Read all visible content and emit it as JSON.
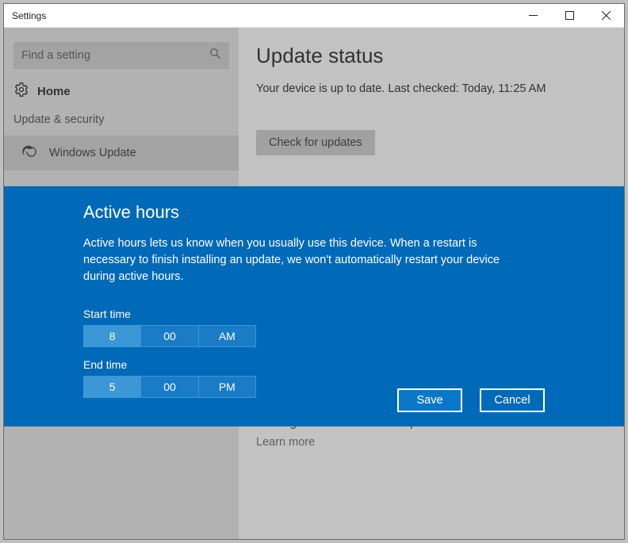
{
  "window": {
    "title": "Settings"
  },
  "sidebar": {
    "search_placeholder": "Find a setting",
    "home_label": "Home",
    "category_label": "Update & security",
    "items": [
      {
        "label": "Windows Update"
      }
    ]
  },
  "main": {
    "heading": "Update status",
    "status_text": "Your device is up to date. Last checked: Today, 11:25 AM",
    "check_button": "Check for updates",
    "info_heading": "Looking for info on the latest updates?",
    "learn_more": "Learn more"
  },
  "dialog": {
    "title": "Active hours",
    "body": "Active hours lets us know when you usually use this device. When a restart is necessary to finish installing an update, we won't automatically restart your device during active hours.",
    "start_label": "Start time",
    "start_hour": "8",
    "start_min": "00",
    "start_ampm": "AM",
    "end_label": "End time",
    "end_hour": "5",
    "end_min": "00",
    "end_ampm": "PM",
    "save": "Save",
    "cancel": "Cancel"
  }
}
